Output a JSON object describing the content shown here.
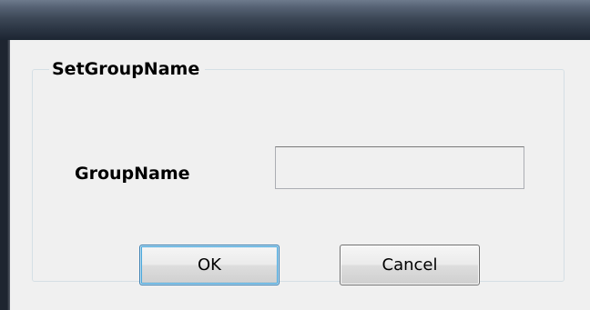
{
  "dialog": {
    "group_title": "SetGroupName",
    "field_label": "GroupName",
    "group_name_value": "",
    "ok_label": "OK",
    "cancel_label": "Cancel"
  }
}
